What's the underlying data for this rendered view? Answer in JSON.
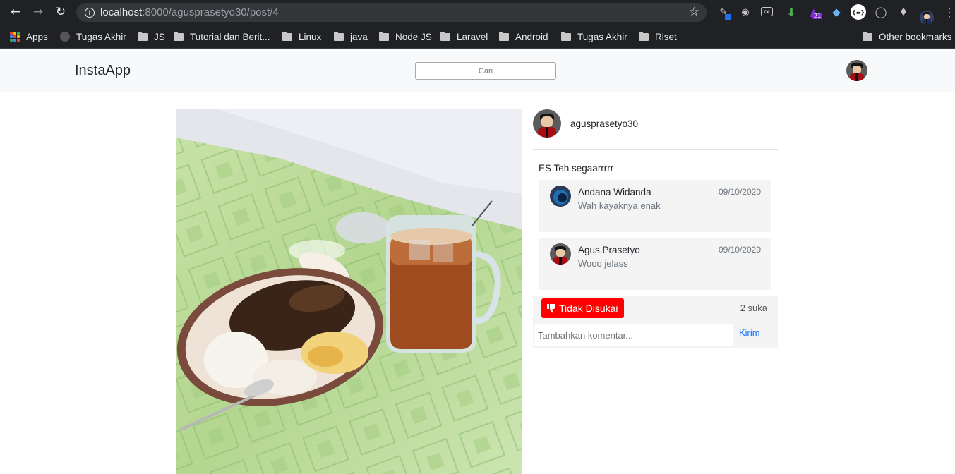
{
  "browser": {
    "url_host": "localhost",
    "url_rest": ":8000/agusprasetyo30/post/4",
    "extension_badge": "21",
    "extension_label": "{≡}",
    "bookmarks": [
      "Apps",
      "Tugas Akhir",
      "JS",
      "Tutorial dan Berit...",
      "Linux",
      "java",
      "Node JS",
      "Laravel",
      "Android",
      "Tugas Akhir",
      "Riset"
    ],
    "other_bookmarks": "Other bookmarks"
  },
  "app": {
    "brand": "InstaApp",
    "search_placeholder": "Cari"
  },
  "post": {
    "author": "agusprasetyo30",
    "caption": "ES Teh segaarrrrr",
    "comments": [
      {
        "name": "Andana Widanda",
        "text": "Wah kayaknya enak",
        "date": "09/10/2020"
      },
      {
        "name": "Agus Prasetyo",
        "text": "Wooo jelass",
        "date": "09/10/2020"
      }
    ],
    "unlike_label": "Tidak Disukai",
    "likes_text": "2 suka",
    "comment_placeholder": "Tambahkan komentar...",
    "send_label": "Kirim"
  },
  "colors": {
    "unlike_button": "#ff0000",
    "send_link": "#0d6efd",
    "navbar_bg": "#f8f9fa"
  },
  "icons": [
    "back-arrow-icon",
    "forward-arrow-icon",
    "reload-icon",
    "info-icon",
    "star-icon",
    "apps-grid-icon",
    "folder-icon",
    "avatar-icon",
    "thumbs-down-icon"
  ]
}
